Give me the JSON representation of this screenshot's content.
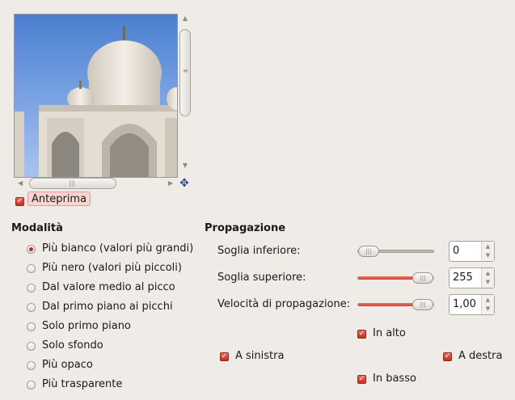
{
  "preview": {
    "label": "Anteprima",
    "checked": true
  },
  "mode": {
    "heading": "Modalità",
    "options": [
      {
        "label": "Più bianco (valori più grandi)",
        "selected": true
      },
      {
        "label": "Più nero (valori più piccoli)",
        "selected": false
      },
      {
        "label": "Dal valore medio al picco",
        "selected": false
      },
      {
        "label": "Dal primo piano ai picchi",
        "selected": false
      },
      {
        "label": "Solo primo piano",
        "selected": false
      },
      {
        "label": "Solo sfondo",
        "selected": false
      },
      {
        "label": "Più opaco",
        "selected": false
      },
      {
        "label": "Più trasparente",
        "selected": false
      }
    ]
  },
  "propagation": {
    "heading": "Propagazione",
    "lower": {
      "label": "Soglia inferiore:",
      "value": "0",
      "fraction": 0.0
    },
    "upper": {
      "label": "Soglia superiore:",
      "value": "255",
      "fraction": 1.0
    },
    "rate": {
      "label": "Velocità di propagazione:",
      "value": "1,00",
      "fraction": 1.0
    },
    "directions": {
      "top": {
        "label": "In alto",
        "checked": true
      },
      "left": {
        "label": "A sinistra",
        "checked": true
      },
      "right": {
        "label": "A destra",
        "checked": true
      },
      "bottom": {
        "label": "In basso",
        "checked": true
      }
    }
  },
  "colors": {
    "accent": "#d23f30",
    "background": "#efebe7"
  },
  "icons": {
    "navigate": "navigate-move-icon"
  }
}
